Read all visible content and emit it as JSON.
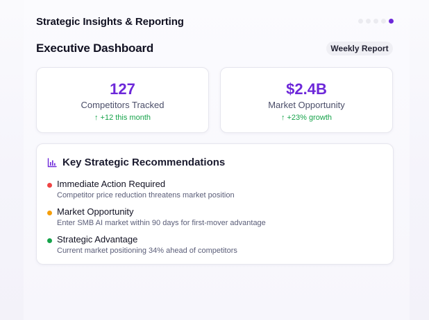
{
  "app_title": "Strategic Insights & Reporting",
  "pager": {
    "count": 5,
    "active_index": 4,
    "active_color": "#6d28d9"
  },
  "section_title": "Executive Dashboard",
  "badge": "Weekly Report",
  "metrics": [
    {
      "value": "127",
      "label": "Competitors Tracked",
      "change": "↑ +12 this month"
    },
    {
      "value": "$2.4B",
      "label": "Market Opportunity",
      "change": "↑ +23% growth"
    }
  ],
  "recommendations": {
    "icon": "bar-chart-icon",
    "title": "Key Strategic Recommendations",
    "items": [
      {
        "title": "Immediate Action Required",
        "description": "Competitor price reduction threatens market position",
        "color": "#ef4444"
      },
      {
        "title": "Market Opportunity",
        "description": "Enter SMB AI market within 90 days for first-mover advantage",
        "color": "#f59e0b"
      },
      {
        "title": "Strategic Advantage",
        "description": "Current market positioning 34% ahead of competitors",
        "color": "#16a34a"
      }
    ]
  },
  "colors": {
    "accent": "#6d28d9",
    "positive": "#16a34a"
  }
}
